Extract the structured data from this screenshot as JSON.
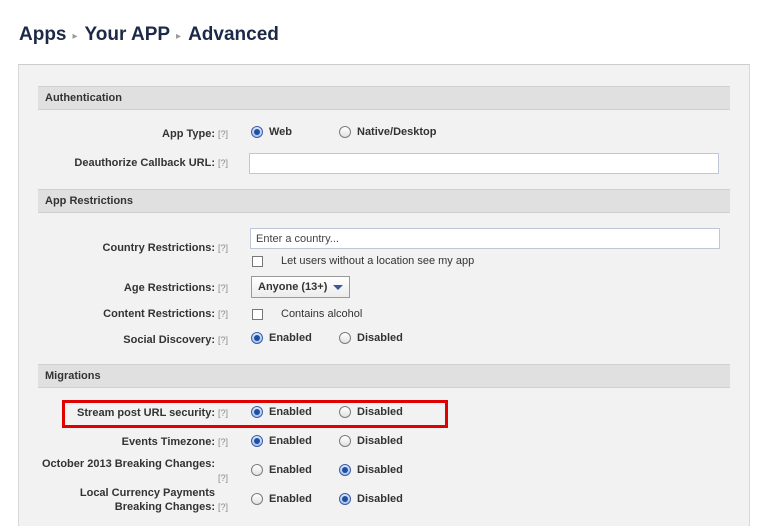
{
  "breadcrumb": {
    "item1": "Apps",
    "item2": "Your APP",
    "item3": "Advanced",
    "separator": "▸"
  },
  "help_marker": "[?]",
  "sections": {
    "authentication": "Authentication",
    "restrictions": "App Restrictions",
    "migrations": "Migrations"
  },
  "auth": {
    "app_type_label": "App Type:",
    "app_type_options": [
      "Web",
      "Native/Desktop"
    ],
    "app_type_selected": "Web",
    "deauth_label": "Deauthorize Callback URL:",
    "deauth_value": ""
  },
  "restrictions": {
    "country_label": "Country Restrictions:",
    "country_placeholder": "Enter a country...",
    "no_location_checkbox": "Let users without a location see my app",
    "age_label": "Age Restrictions:",
    "age_value": "Anyone (13+)",
    "content_label": "Content Restrictions:",
    "alcohol_checkbox": "Contains alcohol",
    "social_label": "Social Discovery:",
    "social_selected": "Enabled"
  },
  "migrations": {
    "stream_label": "Stream post URL security:",
    "stream_selected": "Enabled",
    "timezone_label": "Events Timezone:",
    "timezone_selected": "Enabled",
    "oct2013_label": "October 2013 Breaking Changes:",
    "oct2013_selected": "Disabled",
    "currency_label_line1": "Local Currency Payments",
    "currency_label_line2": "Breaking Changes:",
    "currency_selected": "Disabled"
  },
  "options": {
    "enabled": "Enabled",
    "disabled": "Disabled"
  },
  "colors": {
    "highlight": "#e00000",
    "header_bg": "#e0e0e0",
    "panel_bg": "#f2f2f2"
  }
}
